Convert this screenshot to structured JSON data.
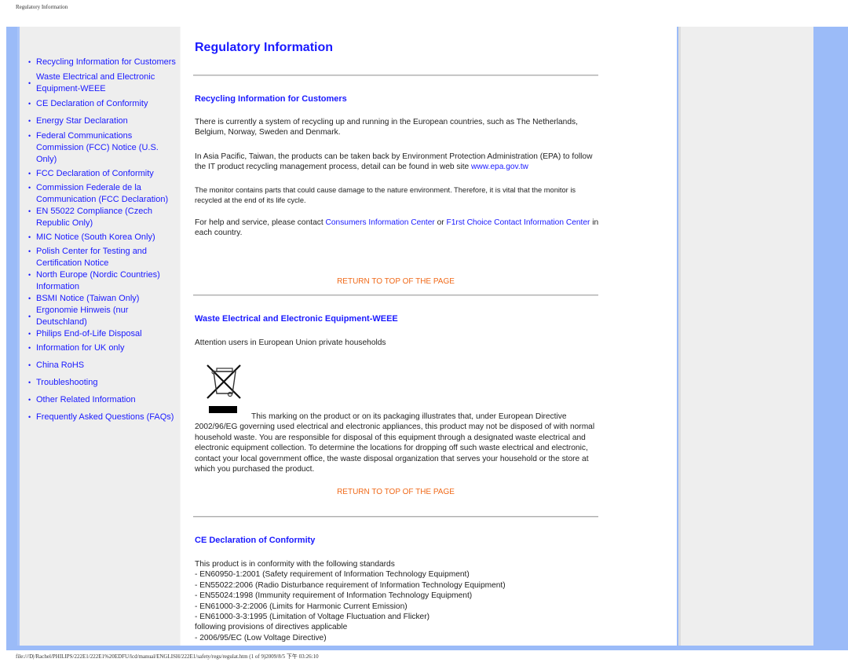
{
  "header": {
    "title": "Regulatory Information"
  },
  "footer": {
    "text": "file:///D|/Rachel/PHILIPS/222E1/222E1%20EDFU/lcd/manual/ENGLISH/222E1/safety/regs/regulat.htm (1 of 9)2009/8/5 下午 03:26:10"
  },
  "colors": {
    "link": "#1a1aff",
    "return_link": "#f06a1a",
    "frame_blue": "#9bbbf8",
    "sidebar_bg": "#eeeeee"
  },
  "sidebar": {
    "items": [
      {
        "label": "Recycling Information for Customers",
        "bullet": "•"
      },
      {
        "label": "Waste Electrical and Electronic Equipment-WEEE",
        "bullet": "•"
      },
      {
        "label": "CE Declaration of Conformity",
        "bullet": "•"
      },
      {
        "label": "Energy Star Declaration",
        "bullet": "•"
      },
      {
        "label": "Federal Communications Commission (FCC) Notice (U.S. Only)",
        "bullet": "•"
      },
      {
        "label": "FCC Declaration of Conformity",
        "bullet": "•"
      },
      {
        "label": "Commission Federale de la Communication (FCC Declaration)",
        "bullet": "•"
      },
      {
        "label": "EN 55022 Compliance (Czech Republic Only)",
        "bullet": "•"
      },
      {
        "label": "MIC Notice (South Korea Only)",
        "bullet": "•"
      },
      {
        "label": "Polish Center for Testing and Certification Notice",
        "bullet": "•"
      },
      {
        "label": "North Europe (Nordic Countries) Information",
        "bullet": "•"
      },
      {
        "label": "BSMI Notice (Taiwan Only)",
        "bullet": "•"
      },
      {
        "label": "Ergonomie Hinweis (nur Deutschland)",
        "bullet": "•"
      },
      {
        "label": "Philips End-of-Life Disposal",
        "bullet": "•"
      },
      {
        "label": "Information for UK only",
        "bullet": "•"
      },
      {
        "label": "China RoHS",
        "bullet": "•"
      },
      {
        "label": "Troubleshooting",
        "bullet": "•"
      },
      {
        "label": "Other Related Information",
        "bullet": "•"
      },
      {
        "label": "Frequently Asked Questions (FAQs)",
        "bullet": "•"
      }
    ]
  },
  "main": {
    "title": "Regulatory Information",
    "return_label": "RETURN TO TOP OF THE PAGE",
    "recycling": {
      "heading": "Recycling Information for Customers",
      "p1": "There is currently a system of recycling up and running in the European countries, such as The Netherlands, Belgium, Norway, Sweden and Denmark.",
      "p2_text": "In Asia Pacific, Taiwan, the products can be taken back by Environment Protection Administration (EPA) to follow the IT product recycling management process, detail can be found in web site ",
      "p2_link": "www.epa.gov.tw",
      "p3": "The monitor contains parts that could cause damage to the nature environment. Therefore, it is vital that the monitor is recycled at the end of its life cycle.",
      "p4_pre": "For help and service, please contact ",
      "p4_link1": "Consumers Information Center",
      "p4_mid": " or ",
      "p4_link2": "F1rst Choice Contact Information Center",
      "p4_post": " in each country."
    },
    "weee": {
      "heading": "Waste Electrical and Electronic Equipment-WEEE",
      "attention": "Attention users in European Union private households",
      "icon": "crossed-out-wheelie-bin-icon",
      "p_first": "This marking on the product or on its packaging illustrates that, under European Directive",
      "p_rest": "2002/96/EG governing used electrical and electronic appliances, this product may not be disposed of with normal household waste. You are responsible for disposal of this equipment through a designated waste electrical and electronic equipment collection. To determine the locations for dropping off such waste electrical and electronic, contact your local government office, the waste disposal organization that serves your household or the store at which you purchased the product."
    },
    "ce": {
      "heading": "CE Declaration of Conformity",
      "intro": "This product is in conformity with the following standards",
      "standards": [
        "- EN60950-1:2001 (Safety requirement of Information Technology Equipment)",
        "- EN55022:2006 (Radio Disturbance requirement of Information Technology Equipment)",
        "- EN55024:1998 (Immunity requirement of Information Technology Equipment)",
        "- EN61000-3-2:2006 (Limits for Harmonic Current Emission)",
        "- EN61000-3-3:1995 (Limitation of Voltage Fluctuation and Flicker)"
      ],
      "directives_intro": "following provisions of directives applicable",
      "directives": [
        "- 2006/95/EC (Low Voltage Directive)"
      ]
    }
  }
}
